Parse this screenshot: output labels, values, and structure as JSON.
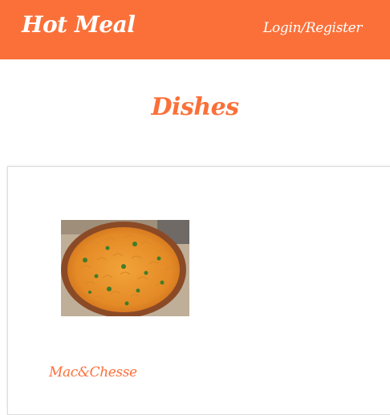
{
  "navbar": {
    "brand": "Hot Meal",
    "auth_link": "Login/Register"
  },
  "main": {
    "title": "Dishes"
  },
  "dishes": [
    {
      "name": "Mac&Chesse",
      "image_icon": "mac-and-cheese-bowl-photo"
    }
  ],
  "colors": {
    "brand_orange": "#fb7039",
    "white": "#ffffff"
  }
}
